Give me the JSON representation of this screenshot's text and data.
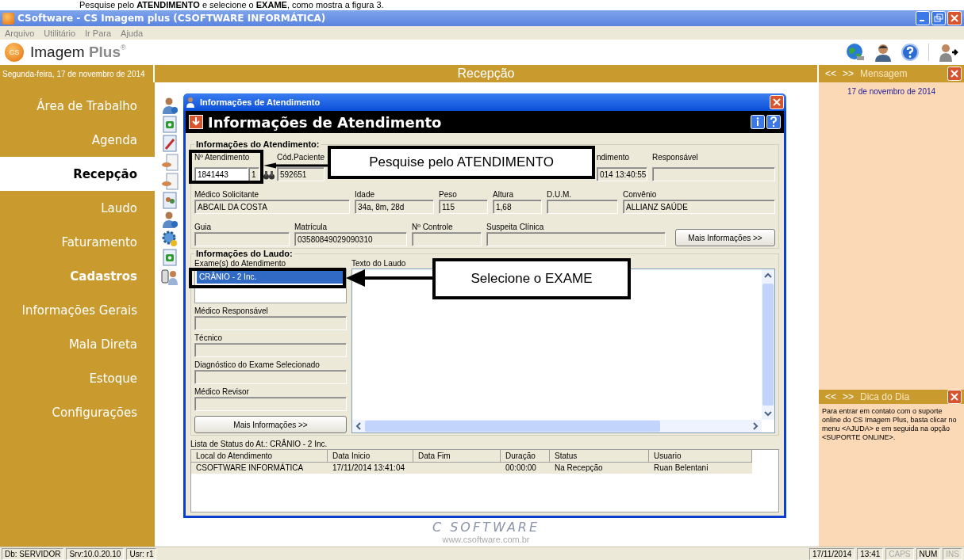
{
  "document_text": "Pesquise pelo **ATENDIMENTO** e selecione o **EXAME**, como mostra a figura 3.",
  "window": {
    "title": "CSoftware - CS Imagem plus (CSOFTWARE INFORMÁTICA)"
  },
  "menu": [
    "Arquivo",
    "Utilitário",
    "Ir Para",
    "Ajuda"
  ],
  "brand": {
    "logo": "CS",
    "name": "Imagem",
    "suffix": "Plus",
    "mark": "®"
  },
  "date_bar": "Segunda-feira, 17 de novembro de 2014",
  "section_title": "Recepção",
  "sidebar": {
    "items": [
      {
        "label": "Área de Trabalho",
        "selected": false,
        "bold": false
      },
      {
        "label": "Agenda",
        "selected": false,
        "bold": false
      },
      {
        "label": "Recepção",
        "selected": true,
        "bold": true
      },
      {
        "label": "Laudo",
        "selected": false,
        "bold": false
      },
      {
        "label": "Faturamento",
        "selected": false,
        "bold": false
      },
      {
        "label": "Cadastros",
        "selected": false,
        "bold": true
      },
      {
        "label": "Informações Gerais",
        "selected": false,
        "bold": false
      },
      {
        "label": "Mala Direta",
        "selected": false,
        "bold": false
      },
      {
        "label": "Estoque",
        "selected": false,
        "bold": false
      },
      {
        "label": "Configurações",
        "selected": false,
        "bold": false
      }
    ]
  },
  "dialog": {
    "title": "Informações de Atendimento",
    "heading": "Informações de Atendimento",
    "attendance_group": {
      "title": "Informações do Atendimento:",
      "row_1": [
        {
          "label": "Nº Atendimento",
          "value": "1841443",
          "sequence": "1"
        },
        {
          "label": "Cód.Paciente",
          "value": "592651"
        },
        {
          "label": "ndimento",
          "value": "014 13:40:55"
        },
        {
          "label": "Responsável"
        }
      ],
      "row_2": [
        {
          "label": "Médico Solicitante",
          "value": "ABCAIL DA COSTA"
        },
        {
          "label": "Idade",
          "value": "34a, 8m, 28d"
        },
        {
          "label": "Peso",
          "value": "115"
        },
        {
          "label": "Altura",
          "value": "1,68"
        },
        {
          "label": "D.U.M."
        },
        {
          "label": "Convênio",
          "value": "ALLIANZ SAÚDE"
        }
      ],
      "row_3": [
        {
          "label": "Guia"
        },
        {
          "label": "Matrícula",
          "value": "03580849029090310"
        },
        {
          "label": "Nº Controle"
        },
        {
          "label": "Suspeita Clínica"
        }
      ],
      "button": "Mais Informações >>"
    },
    "report_group": {
      "title": "Informações do Laudo:",
      "exams_label": "Exame(s) do Atendimento",
      "exams": [
        {
          "label": "CRÂNIO - 2 Inc.",
          "selected": true
        }
      ],
      "fields": [
        {
          "label": "Médico Responsável"
        },
        {
          "label": "Técnico"
        },
        {
          "label": "Diagnóstico do Exame Selecionado"
        },
        {
          "label": "Médico Revisor"
        }
      ],
      "button": "Mais Informações >>",
      "text_label": "Texto do Laudo"
    },
    "status_list": {
      "title": "Lista de Status do At.: CRÂNIO - 2 Inc.",
      "columns": [
        "Local do Atendimento",
        "Data Inicio",
        "Data Fim",
        "Duração",
        "Status",
        "Usuario"
      ],
      "rows": [
        [
          "CSOFTWARE INFORMÁTICA",
          "17/11/2014 13:41:04",
          "",
          "00:00:00",
          "Na Recepção",
          "Ruan Belentani"
        ]
      ]
    }
  },
  "message_panel": {
    "nav": [
      "<<",
      ">>"
    ],
    "title": "Mensagem",
    "date": "17 de novembro de 2014"
  },
  "tip_panel": {
    "nav": [
      "<<",
      ">>"
    ],
    "title": "Dica do Dia",
    "text": "Para entrar em contato com o suporte online do CS Imagem Plus, basta clicar no menu <AJUDA> e em seguida na opção <SUPORTE ONLINE>."
  },
  "footer_logo": {
    "name": "C SOFTWARE",
    "url": "www.csoftware.com.br"
  },
  "callouts": [
    {
      "text": "Pesquise pelo ATENDIMENTO"
    },
    {
      "text": "Selecione o EXAME"
    }
  ],
  "status_bar": {
    "left": [
      "Db: SERVIDOR",
      "Srv:10.0.20.10",
      "Usr: r1"
    ],
    "right": [
      {
        "text": "17/11/2014",
        "on": true
      },
      {
        "text": "13:41",
        "on": true
      },
      {
        "text": "CAPS",
        "on": false
      },
      {
        "text": "NUM",
        "on": true
      },
      {
        "text": "INS",
        "on": false
      }
    ]
  }
}
